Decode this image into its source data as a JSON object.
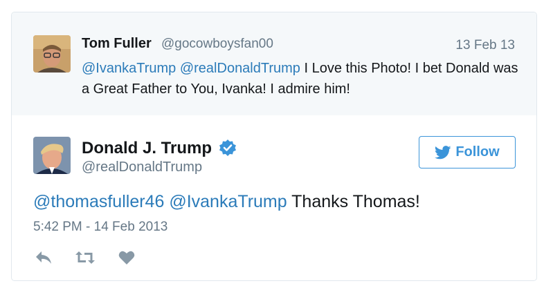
{
  "parent_tweet": {
    "author_name": "Tom Fuller",
    "handle": "@gocowboysfan00",
    "date": "13 Feb 13",
    "mention1": "@IvankaTrump",
    "mention2": "@realDonaldTrump",
    "text": " I Love this Photo! I bet Donald was a Great Father to You, Ivanka! I admire him!"
  },
  "main_tweet": {
    "author_name": "Donald J. Trump",
    "handle": "@realDonaldTrump",
    "verified": true,
    "follow_label": "Follow",
    "mention1": "@thomasfuller46",
    "mention2": "@IvankaTrump",
    "text": " Thanks Thomas!",
    "timestamp": "5:42 PM - 14 Feb 2013"
  },
  "actions": [
    "reply-icon",
    "retweet-icon",
    "like-icon"
  ],
  "colors": {
    "link": "#2b7bb9",
    "follow": "#3b94d9",
    "muted": "#657786",
    "parent_bg": "#f5f8fa",
    "icon": "#8899a6"
  }
}
